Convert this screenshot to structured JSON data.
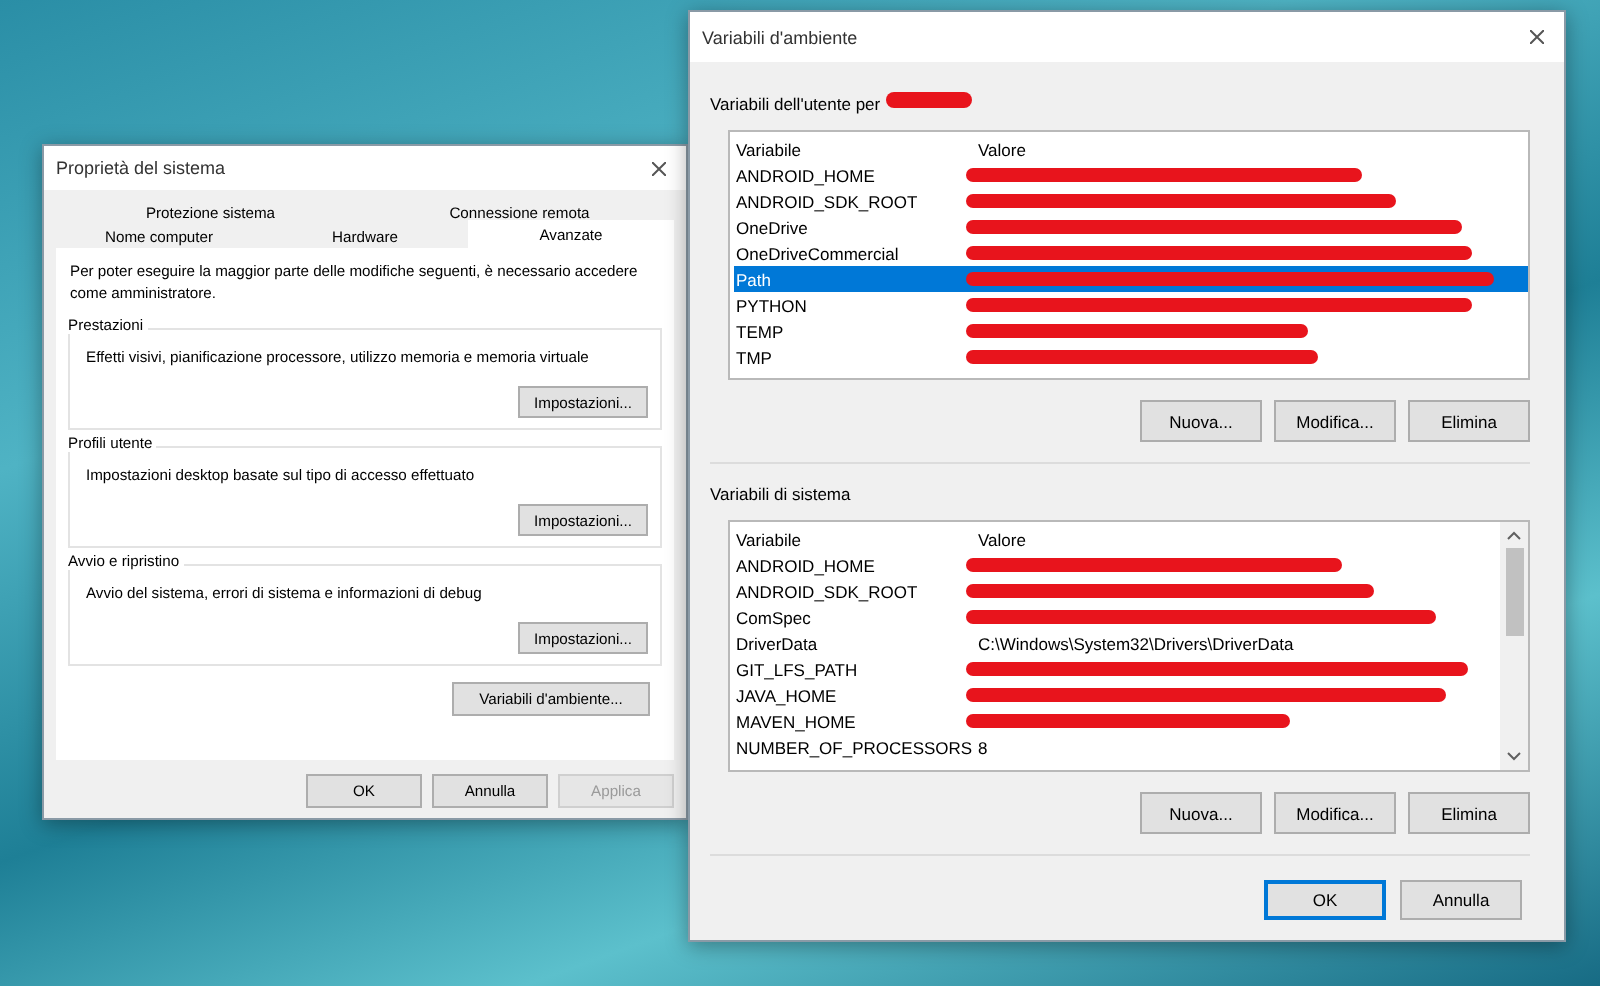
{
  "system_properties": {
    "title": "Proprietà del sistema",
    "tab_rows": [
      [
        {
          "label": "Protezione sistema",
          "selected": false
        },
        {
          "label": "Connessione remota",
          "selected": false
        }
      ],
      [
        {
          "label": "Nome computer",
          "selected": false
        },
        {
          "label": "Hardware",
          "selected": false
        },
        {
          "label": "Avanzate",
          "selected": true
        }
      ]
    ],
    "notice": "Per poter eseguire la maggior parte delle modifiche seguenti, è necessario accedere come amministratore.",
    "groups": [
      {
        "title": "Prestazioni",
        "description": "Effetti visivi, pianificazione processore, utilizzo memoria e memoria virtuale",
        "button": "Impostazioni..."
      },
      {
        "title": "Profili utente",
        "description": "Impostazioni desktop basate sul tipo di accesso effettuato",
        "button": "Impostazioni..."
      },
      {
        "title": "Avvio e ripristino",
        "description": "Avvio del sistema, errori di sistema e informazioni di debug",
        "button": "Impostazioni..."
      }
    ],
    "environment_button": "Variabili d'ambiente...",
    "buttons": [
      {
        "label": "OK",
        "disabled": false
      },
      {
        "label": "Annulla",
        "disabled": false
      },
      {
        "label": "Applica",
        "disabled": true
      }
    ]
  },
  "environment_variables": {
    "title": "Variabili d'ambiente",
    "user_variables": {
      "label": "Variabili dell'utente per",
      "redacted": true,
      "columns": [
        "Variabile",
        "Valore"
      ],
      "rows": [
        {
          "name": "ANDROID_HOME",
          "redacted": true,
          "selected": false
        },
        {
          "name": "ANDROID_SDK_ROOT",
          "redacted": true,
          "selected": false
        },
        {
          "name": "OneDrive",
          "redacted": true,
          "selected": false
        },
        {
          "name": "OneDriveCommercial",
          "redacted": true,
          "selected": false
        },
        {
          "name": "Path",
          "redacted": true,
          "selected": true
        },
        {
          "name": "PYTHON",
          "redacted": true,
          "selected": false
        },
        {
          "name": "TEMP",
          "redacted": true,
          "selected": false
        },
        {
          "name": "TMP",
          "redacted": true,
          "selected": false
        }
      ],
      "buttons": [
        "Nuova...",
        "Modifica...",
        "Elimina"
      ]
    },
    "system_variables": {
      "label": "Variabili di sistema",
      "columns": [
        "Variabile",
        "Valore"
      ],
      "rows": [
        {
          "name": "ANDROID_HOME",
          "redacted": true,
          "selected": false
        },
        {
          "name": "ANDROID_SDK_ROOT",
          "redacted": true,
          "selected": false
        },
        {
          "name": "ComSpec",
          "redacted": true,
          "selected": false
        },
        {
          "name": "DriverData",
          "value": "C:\\Windows\\System32\\Drivers\\DriverData",
          "redacted": false,
          "selected": false
        },
        {
          "name": "GIT_LFS_PATH",
          "redacted": true,
          "selected": false
        },
        {
          "name": "JAVA_HOME",
          "redacted": true,
          "selected": false
        },
        {
          "name": "MAVEN_HOME",
          "redacted": true,
          "selected": false
        },
        {
          "name": "NUMBER_OF_PROCESSORS",
          "value": "8",
          "redacted": false,
          "selected": false
        }
      ],
      "buttons": [
        "Nuova...",
        "Modifica...",
        "Elimina"
      ]
    },
    "buttons": [
      {
        "label": "OK",
        "default": true
      },
      {
        "label": "Annulla",
        "default": false
      }
    ]
  }
}
